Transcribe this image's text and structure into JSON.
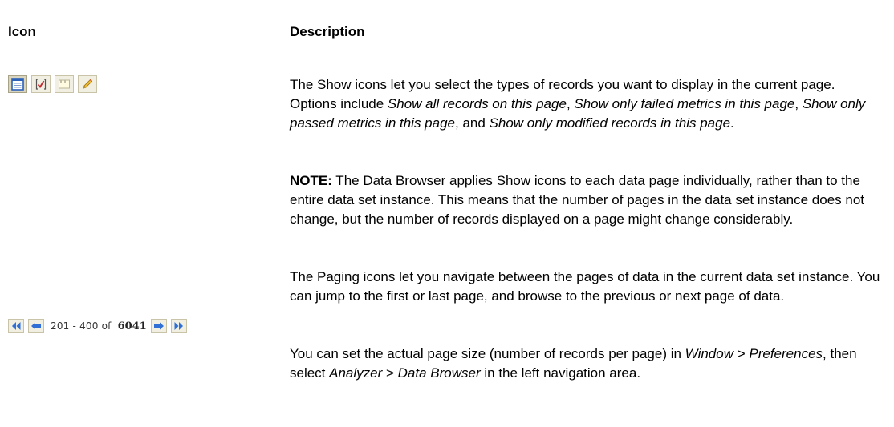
{
  "table": {
    "headers": {
      "icon": "Icon",
      "description": "Description"
    }
  },
  "show_icons": {
    "icons": [
      "show-all-records-icon",
      "show-failed-metrics-icon",
      "show-passed-metrics-icon",
      "show-modified-records-icon"
    ],
    "description": {
      "intro": "The Show icons let you select the types of records you want to display in the current page. Options include ",
      "option1": "Show all records on this page",
      "sep1": ", ",
      "option2": "Show only failed metrics in this page",
      "sep2": ", ",
      "option3": "Show only passed metrics in this page",
      "sep3": ", and ",
      "option4": "Show only modified records in this page",
      "end": "."
    },
    "note": {
      "label": "NOTE:",
      "text": " The Data Browser applies Show icons to each data page individually, rather than to the entire data set instance. This means that the number of pages in the data set instance does not change, but the number of records displayed on a page might change considerably."
    }
  },
  "paging": {
    "range": "201 - 400 of",
    "total": "6041",
    "description": "The Paging icons let you navigate between the pages of data in the current data set instance. You can jump to the first or last page, and browse to the previous or next page of data.",
    "page_size": {
      "intro": "You can set the actual page size (number of records per page) in ",
      "menu1": "Window",
      "gt1": " > ",
      "menu2": "Preferences",
      "mid": ", then select ",
      "menu3": "Analyzer",
      "gt2": " > ",
      "menu4": "Data Browser",
      "end": " in the left navigation area."
    }
  },
  "colors": {
    "toolbar_bg": "#f1efe2",
    "toolbar_border": "#c9c3a8",
    "icon_blue": "#2c62b8",
    "arrow_blue": "#2f6fd6"
  }
}
